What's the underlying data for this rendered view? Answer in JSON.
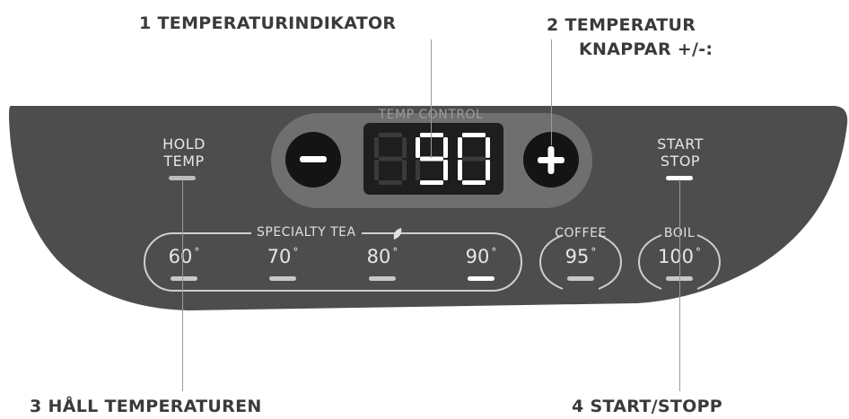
{
  "callouts": {
    "c1": {
      "num": "1",
      "text": "TEMPERATURINDIKATOR"
    },
    "c2": {
      "num": "2",
      "line1": "TEMPERATUR",
      "line2": "KNAPPAR +/-:"
    },
    "c3": {
      "num": "3",
      "text": "HÅLL TEMPERATUREN"
    },
    "c4": {
      "num": "4",
      "text": "START/STOPP"
    }
  },
  "panel": {
    "temp_control_label": "TEMP CONTROL",
    "display_value": "90",
    "hold_label_line1": "HOLD",
    "hold_label_line2": "TEMP",
    "start_label_line1": "START",
    "start_label_line2": "STOP",
    "specialty_label": "SPECIALTY TEA",
    "presets": [
      {
        "value": "60",
        "unit": "°"
      },
      {
        "value": "70",
        "unit": "°"
      },
      {
        "value": "80",
        "unit": "°"
      },
      {
        "value": "90",
        "unit": "°"
      }
    ],
    "coffee": {
      "label": "COFFEE",
      "value": "95",
      "unit": "°"
    },
    "boil": {
      "label": "BOIL",
      "value": "100",
      "unit": "°"
    },
    "minus_icon": "minus-icon",
    "plus_icon": "plus-icon",
    "leaf_icon": "leaf-icon"
  },
  "colors": {
    "panel": "#4d4d4d",
    "inner_panel": "#6f6f6f",
    "display_bg": "#1e1e1e",
    "button": "#141414",
    "text": "#e6e6e6",
    "leader": "#9a9a9a",
    "callout": "#3a3a3a"
  }
}
